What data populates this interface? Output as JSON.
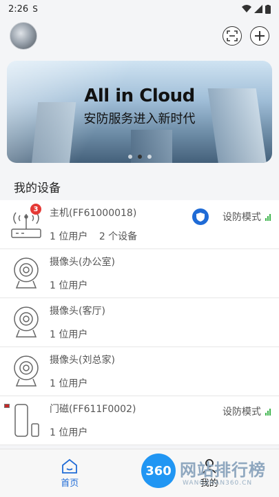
{
  "status_bar": {
    "time": "2:26",
    "notif_icon": "S"
  },
  "banner": {
    "headline": "All in Cloud",
    "subline": "安防服务进入新时代",
    "page_count": 3,
    "active_page": 2
  },
  "section": {
    "title": "我的设备"
  },
  "devices": [
    {
      "type": "hub",
      "name": "主机(FF61000018)",
      "users": "1 位用户",
      "devices": "2 个设备",
      "mode": "设防模式",
      "badge": "3"
    },
    {
      "type": "camera",
      "name": "摄像头(办公室)",
      "users": "1 位用户"
    },
    {
      "type": "camera",
      "name": "摄像头(客厅)",
      "users": "1 位用户"
    },
    {
      "type": "camera",
      "name": "摄像头(刘总家)",
      "users": "1 位用户"
    },
    {
      "type": "door",
      "name": "门磁(FF611F0002)",
      "users": "1 位用户",
      "mode": "设防模式"
    }
  ],
  "nav": {
    "home": "首页",
    "mine": "我的"
  },
  "watermark": {
    "logo": "360",
    "text": "网站排行榜",
    "sub": "WANGZHAN360.CN"
  },
  "colors": {
    "accent": "#1f6bd6",
    "signal": "#3cb44b",
    "badge": "#e53935"
  }
}
